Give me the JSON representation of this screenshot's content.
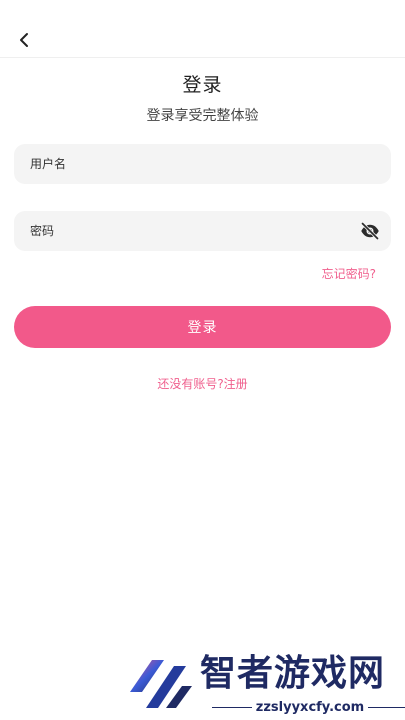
{
  "header": {
    "back_icon": "chevron-left-icon"
  },
  "login": {
    "title": "登录",
    "subtitle": "登录享受完整体验",
    "username_placeholder": "用户名",
    "password_placeholder": "密码",
    "visibility_icon": "eye-off-icon",
    "forgot_password": "忘记密码?",
    "submit_label": "登录",
    "register_prompt": "还没有账号?注册"
  },
  "watermark": {
    "brand": "智者游戏网",
    "url": "zzslyyxcfy.com"
  },
  "colors": {
    "accent": "#f2598a",
    "link": "#f0608e",
    "field_bg": "#f4f4f4",
    "watermark": "#1f2a63"
  }
}
